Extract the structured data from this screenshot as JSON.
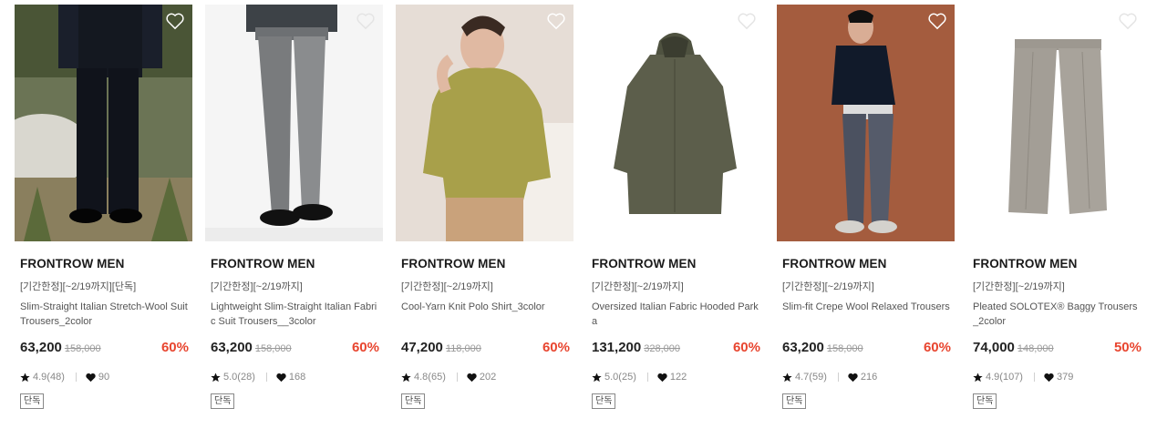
{
  "products": [
    {
      "brand": "FRONTROW MEN",
      "promo": "[기간한정][~2/19까지][단독]",
      "name": "Slim-Straight Italian Stretch-Wool Suit Trousers_2color",
      "price": "63,200",
      "original_price": "158,000",
      "discount": "60%",
      "rating": "4.9(48)",
      "likes": "90",
      "badge": "단독",
      "photo": "model in black suit on rocky hillside"
    },
    {
      "brand": "FRONTROW MEN",
      "promo": "[기간한정][~2/19까지]",
      "name": "Lightweight Slim-Straight Italian Fabric Suit Trousers__3color",
      "price": "63,200",
      "original_price": "158,000",
      "discount": "60%",
      "rating": "5.0(28)",
      "likes": "168",
      "badge": "단독",
      "photo": "grey suit trousers with black shoes"
    },
    {
      "brand": "FRONTROW MEN",
      "promo": "[기간한정][~2/19까지]",
      "name": "Cool-Yarn Knit Polo Shirt_3color",
      "price": "47,200",
      "original_price": "118,000",
      "discount": "60%",
      "rating": "4.8(65)",
      "likes": "202",
      "badge": "단독",
      "photo": "model in olive knit polo"
    },
    {
      "brand": "FRONTROW MEN",
      "promo": "[기간한정][~2/19까지]",
      "name": "Oversized Italian Fabric Hooded Parka",
      "price": "131,200",
      "original_price": "328,000",
      "discount": "60%",
      "rating": "5.0(25)",
      "likes": "122",
      "badge": "단독",
      "photo": "khaki hooded parka"
    },
    {
      "brand": "FRONTROW MEN",
      "promo": "[기간한정][~2/19까지]",
      "name": "Slim-fit Crepe Wool Relaxed Trousers",
      "price": "63,200",
      "original_price": "158,000",
      "discount": "60%",
      "rating": "4.7(59)",
      "likes": "216",
      "badge": "단독",
      "photo": "model in navy sweater and grey trousers on terracotta background"
    },
    {
      "brand": "FRONTROW MEN",
      "promo": "[기간한정][~2/19까지]",
      "name": "Pleated SOLOTEX® Baggy Trousers_2color",
      "price": "74,000",
      "original_price": "148,000",
      "discount": "50%",
      "rating": "4.9(107)",
      "likes": "379",
      "badge": "단독",
      "photo": "beige pleated baggy trousers"
    }
  ],
  "colors": {
    "discount": "#e8452f",
    "text": "#222222",
    "muted": "#888888"
  },
  "icons": {
    "wishlist": "heart-outline-icon",
    "rating": "star-icon",
    "likes": "heart-filled-icon"
  }
}
